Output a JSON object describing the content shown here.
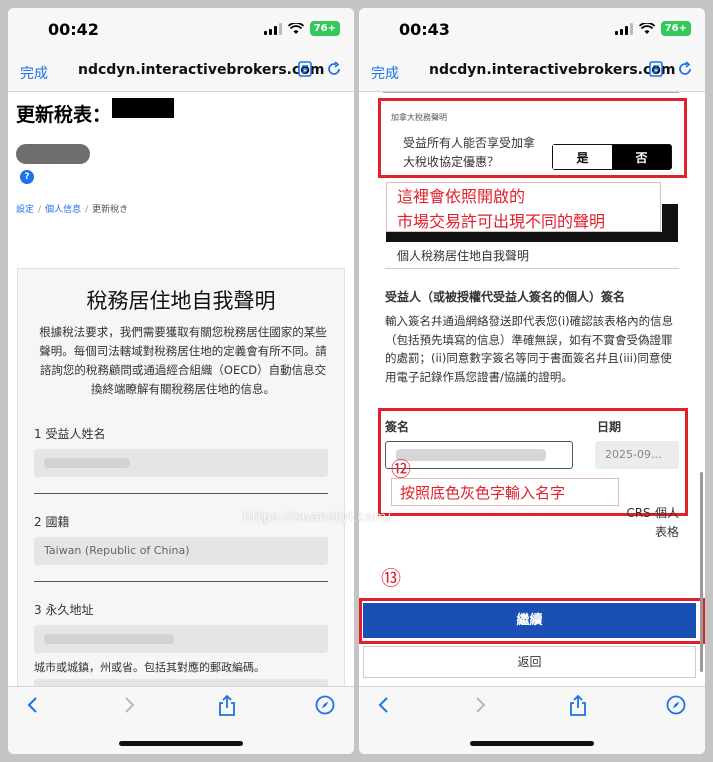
{
  "phone1": {
    "status": {
      "time": "00:42",
      "battery": "76+"
    },
    "browser": {
      "done": "完成",
      "url": "ndcdyn.interactivebrokers.com"
    },
    "page_title": "更新稅表：",
    "help_icon": "?",
    "breadcrumb": {
      "item1": "設定",
      "item2": "個人信息",
      "item3": "更新稅き"
    },
    "form": {
      "title": "稅務居住地自我聲明",
      "description": "根據稅法要求，我們需要獲取有關您稅務居住國家的某些聲明。每個司法轄域對稅務居住地的定義會有所不同。請諮詢您的稅務顧問或通過經合組織（OECD）自動信息交換終端瞭解有關稅務居住地的信息。",
      "field1_label": "1 受益人姓名",
      "field2_label": "2 國籍",
      "field2_value": "Taiwan (Republic of China)",
      "field3_label": "3 永久地址",
      "field3_hint": "城市或城鎮，州或省。包括其對應的郵政編碼。"
    }
  },
  "phone2": {
    "status": {
      "time": "00:43",
      "battery": "76+"
    },
    "browser": {
      "done": "完成",
      "url": "ndcdyn.interactivebrokers.com"
    },
    "canada": {
      "small_title": "加拿大稅務聲明",
      "question": "受益所有人能否享受加拿大稅收協定優惠？",
      "yes": "是",
      "no": "否"
    },
    "annotation1": {
      "line1": "這裡會依照開啟的",
      "line2": "市場交易許可出現不同的聲明"
    },
    "sub_heading": "個人稅務居住地自我聲明",
    "signature": {
      "heading": "受益人（或被授權代受益人簽名的個人）簽名",
      "description": "輸入簽名幷通過網絡發送即代表您(i)確認該表格內的信息（包括預先填寫的信息）準確無誤，如有不實會受偽證罪的處罰；(ii)同意數字簽名等同于書面簽名幷且(iii)同意使用電子記錄作爲您證書/協議的證明。",
      "name_label": "簽名",
      "date_label": "日期",
      "date_value": "2025-09..."
    },
    "marker12": "⑫",
    "annotation2": "按照底色灰色字輸入名字",
    "crs_line1": "CRS-個人",
    "crs_line2": "表格",
    "marker13": "⑬",
    "continue": "繼續",
    "back": "返回"
  },
  "watermark": "https://xuanstyl.com/",
  "colors": {
    "accent": "#1a73e8",
    "primary_button": "#1a4fb5",
    "annotation_red": "#e0202a",
    "battery_green": "#34c759"
  },
  "icons": [
    "reader-icon",
    "reload-icon",
    "back-icon",
    "forward-icon",
    "share-icon",
    "compass-icon"
  ]
}
